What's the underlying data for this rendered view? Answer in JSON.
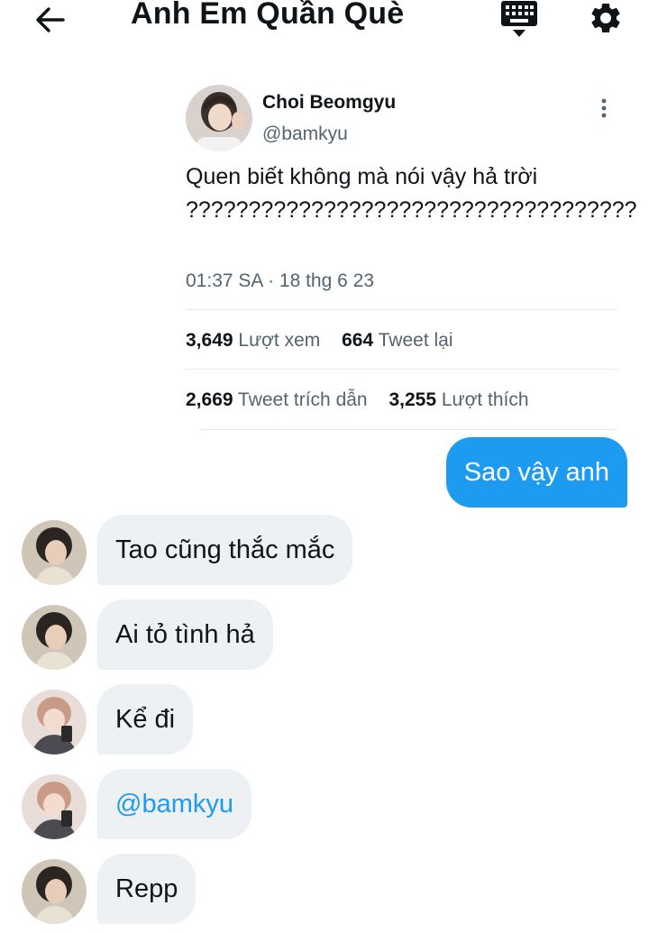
{
  "header": {
    "back_icon": "arrow-left-icon",
    "title": "Anh Em Quần Què",
    "keyboard_icon": "keyboard-icon",
    "settings_icon": "gear-icon"
  },
  "tweet": {
    "author_name": "Choi Beomgyu",
    "author_handle": "@bamkyu",
    "text": "Quen biết không mà nói vậy hả trời ????????????????????????????????????",
    "time": "01:37 SA · 18 thg 6 23",
    "stats": {
      "views_count": "3,649",
      "views_label": "Lượt xem",
      "retweets_count": "664",
      "retweets_label": "Tweet lại",
      "quotes_count": "2,669",
      "quotes_label": "Tweet trích dẫn",
      "likes_count": "3,255",
      "likes_label": "Lượt thích"
    }
  },
  "messages": {
    "outgoing": "Sao vậy anh",
    "incoming": [
      "Tao cũng thắc mắc",
      "Ai tỏ tình hả",
      "Kể đi",
      "@bamkyu",
      "Repp"
    ]
  },
  "colors": {
    "accent": "#1d9bf0",
    "incoming_bubble": "#eef1f3",
    "secondary_text": "#536471"
  }
}
